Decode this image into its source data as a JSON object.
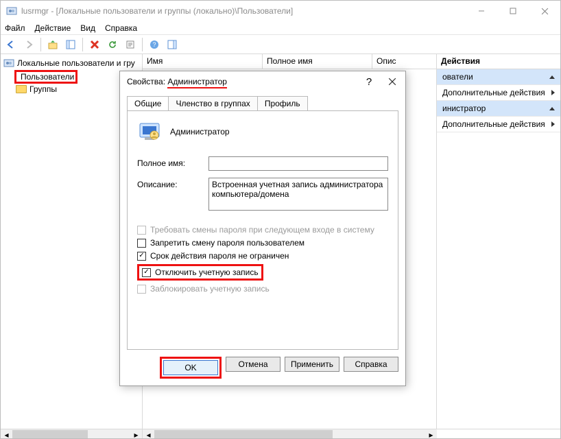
{
  "window": {
    "title": "lusrmgr - [Локальные пользователи и группы (локально)\\Пользователи]"
  },
  "menu": {
    "file": "Файл",
    "action": "Действие",
    "view": "Вид",
    "help": "Справка"
  },
  "tree": {
    "root": "Локальные пользователи и гру",
    "users": "Пользователи",
    "groups": "Группы"
  },
  "listcols": {
    "name": "Имя",
    "fullname": "Полное имя",
    "desc": "Опис"
  },
  "actions": {
    "header": "Действия",
    "users_row": "ователи",
    "more1": "Дополнительные действия",
    "admin_row": "инистратор",
    "more2": "Дополнительные действия"
  },
  "dialog": {
    "title_prefix": "Свойства: ",
    "title_obj": "Администратор",
    "tabs": {
      "general": "Общие",
      "member": "Членство в группах",
      "profile": "Профиль"
    },
    "user_display": "Администратор",
    "fullname_label": "Полное имя:",
    "fullname_value": "",
    "desc_label": "Описание:",
    "desc_value": "Встроенная учетная запись администратора компьютера/домена",
    "cb_must_change": "Требовать смены пароля при следующем входе в систему",
    "cb_no_change": "Запретить смену пароля пользователем",
    "cb_no_expire": "Срок действия пароля не ограничен",
    "cb_disable": "Отключить учетную запись",
    "cb_locked": "Заблокировать учетную запись",
    "btn_ok": "OK",
    "btn_cancel": "Отмена",
    "btn_apply": "Применить",
    "btn_help": "Справка"
  }
}
